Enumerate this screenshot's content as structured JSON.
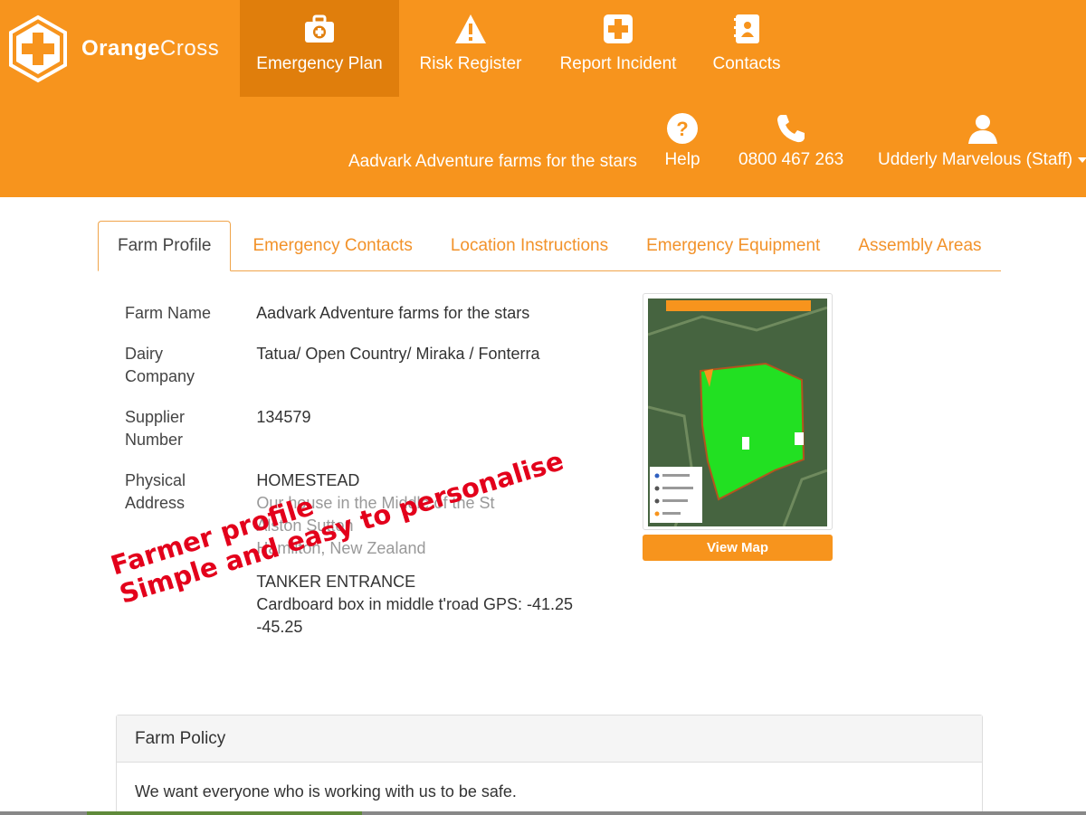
{
  "brand": {
    "name_bold": "Orange",
    "name_light": "Cross",
    "accent": "#f7941d",
    "accent_dark": "#e07e0c"
  },
  "nav": [
    {
      "label": "Emergency Plan",
      "icon": "medkit-icon",
      "active": true
    },
    {
      "label": "Risk Register",
      "icon": "warning-icon",
      "active": false
    },
    {
      "label": "Report Incident",
      "icon": "plus-cross-icon",
      "active": false
    },
    {
      "label": "Contacts",
      "icon": "contact-book-icon",
      "active": false
    }
  ],
  "subnav": {
    "farm_name": "Aadvark Adventure farms for the stars",
    "help_label": "Help",
    "phone": "0800 467 263",
    "user": "Udderly Marvelous (Staff)"
  },
  "tabs": [
    {
      "label": "Farm Profile",
      "active": true
    },
    {
      "label": "Emergency Contacts",
      "active": false
    },
    {
      "label": "Location Instructions",
      "active": false
    },
    {
      "label": "Emergency Equipment",
      "active": false
    },
    {
      "label": "Assembly Areas",
      "active": false
    }
  ],
  "profile": {
    "farm_name_label": "Farm Name",
    "farm_name_value": "Aadvark Adventure farms for the stars",
    "dairy_label": "Dairy Company",
    "dairy_value": "Tatua/ Open Country/ Miraka / Fonterra",
    "supplier_label": "Supplier Number",
    "supplier_value": "134579",
    "address_label": "Physical Address",
    "address_lines": [
      "HOMESTEAD",
      "Our house in the Middle of the St",
      "Alston Sutton",
      "Hamilton, New Zealand",
      "TANKER ENTRANCE",
      "Cardboard box in middle t'road GPS: -41.25",
      "-45.25"
    ]
  },
  "map": {
    "view_label": "View Map",
    "farm_fill": "#22e022"
  },
  "annotation": {
    "line1": "Farmer profile",
    "line2": "Simple and easy to personalise",
    "color": "#e3001b"
  },
  "policy": {
    "title": "Farm Policy",
    "text": "We want everyone who is working with us to be safe."
  }
}
